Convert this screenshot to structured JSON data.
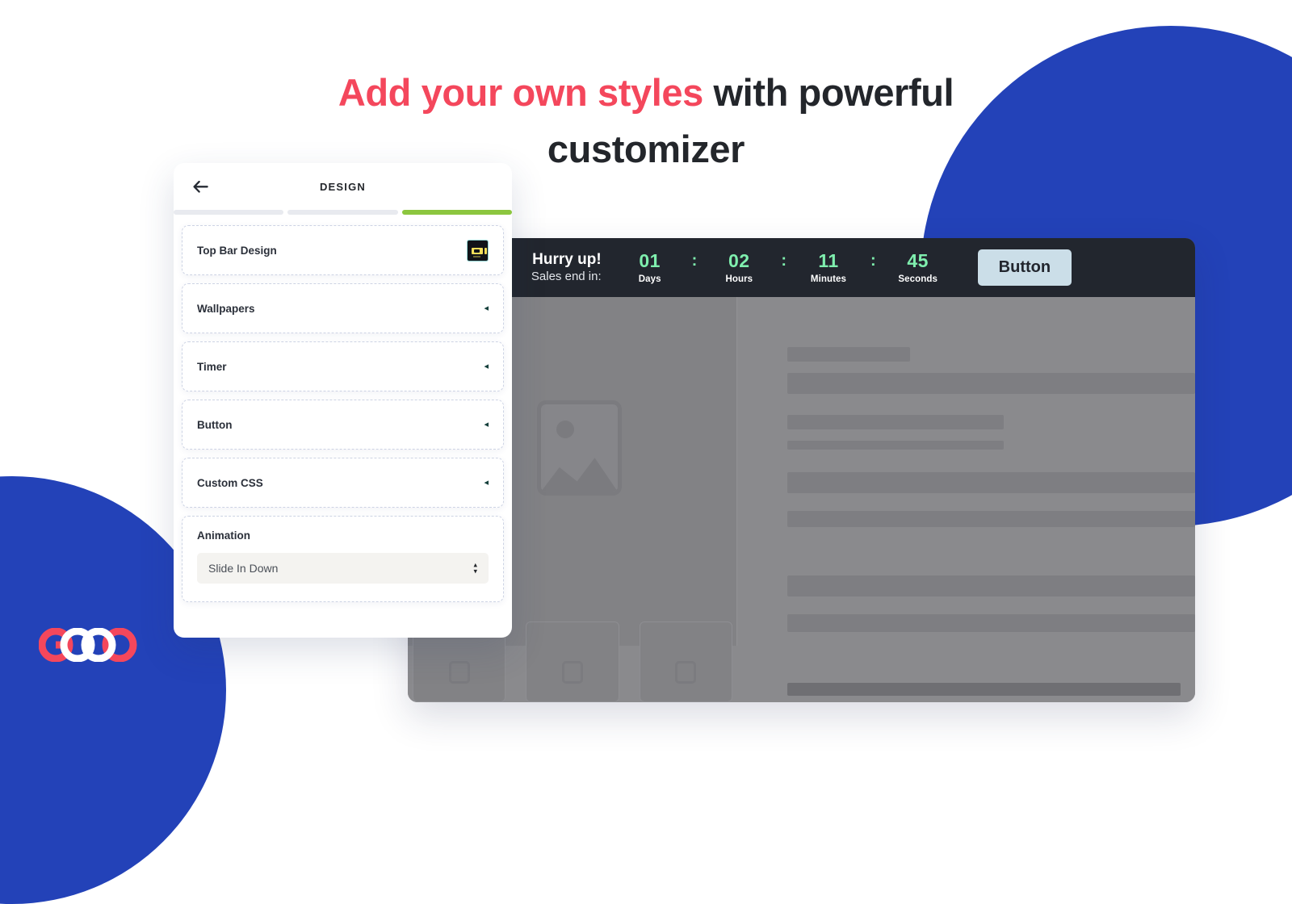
{
  "headline": {
    "accent_text": "Add your own styles",
    "rest_text": " with powerful customizer",
    "accent_color": "#F4475C",
    "text_color": "#23262B"
  },
  "brand": {
    "logo_name": "GOOO",
    "logo_red": "#F4475C",
    "logo_white": "#FFFFFF",
    "background_blue": "#2342B8"
  },
  "customizer_panel": {
    "back_icon": "arrow-left-icon",
    "title": "DESIGN",
    "progress": {
      "segments": 3,
      "completed_index": 2,
      "active_color": "#8CC63F",
      "inactive_color": "#E8EAEF"
    },
    "items": [
      {
        "label": "Top Bar Design",
        "accessory": "thumbnail"
      },
      {
        "label": "Wallpapers",
        "accessory": "chevron",
        "chevron": "◂"
      },
      {
        "label": "Timer",
        "accessory": "chevron",
        "chevron": "◂"
      },
      {
        "label": "Button",
        "accessory": "chevron",
        "chevron": "◂"
      },
      {
        "label": "Custom CSS",
        "accessory": "chevron",
        "chevron": "◂"
      }
    ],
    "animation": {
      "label": "Animation",
      "selected_value": "Slide In Down",
      "stepper_up": "▴",
      "stepper_down": "▾",
      "options": [
        "Slide In Down"
      ]
    }
  },
  "site_preview": {
    "topbar": {
      "headline": "Hurry up!",
      "subline": "Sales end in:",
      "separator": ":",
      "digit_color": "#7FEFAE",
      "background": "#22262E",
      "countdown": [
        {
          "value": "01",
          "label": "Days"
        },
        {
          "value": "02",
          "label": "Hours"
        },
        {
          "value": "11",
          "label": "Minutes"
        },
        {
          "value": "45",
          "label": "Seconds"
        }
      ],
      "cta_label": "Button",
      "cta_background": "#CBDEE8"
    },
    "hero_placeholder_icon": "image-placeholder-icon",
    "skeleton_bar_widths": [
      "30%",
      "100%",
      "62%",
      "62%",
      "100%",
      "100%",
      "100%",
      "100%"
    ],
    "card_placeholders": [
      {
        "icon": "image-placeholder-icon"
      },
      {
        "icon": "image-placeholder-icon"
      },
      {
        "icon": "image-placeholder-icon"
      }
    ]
  }
}
